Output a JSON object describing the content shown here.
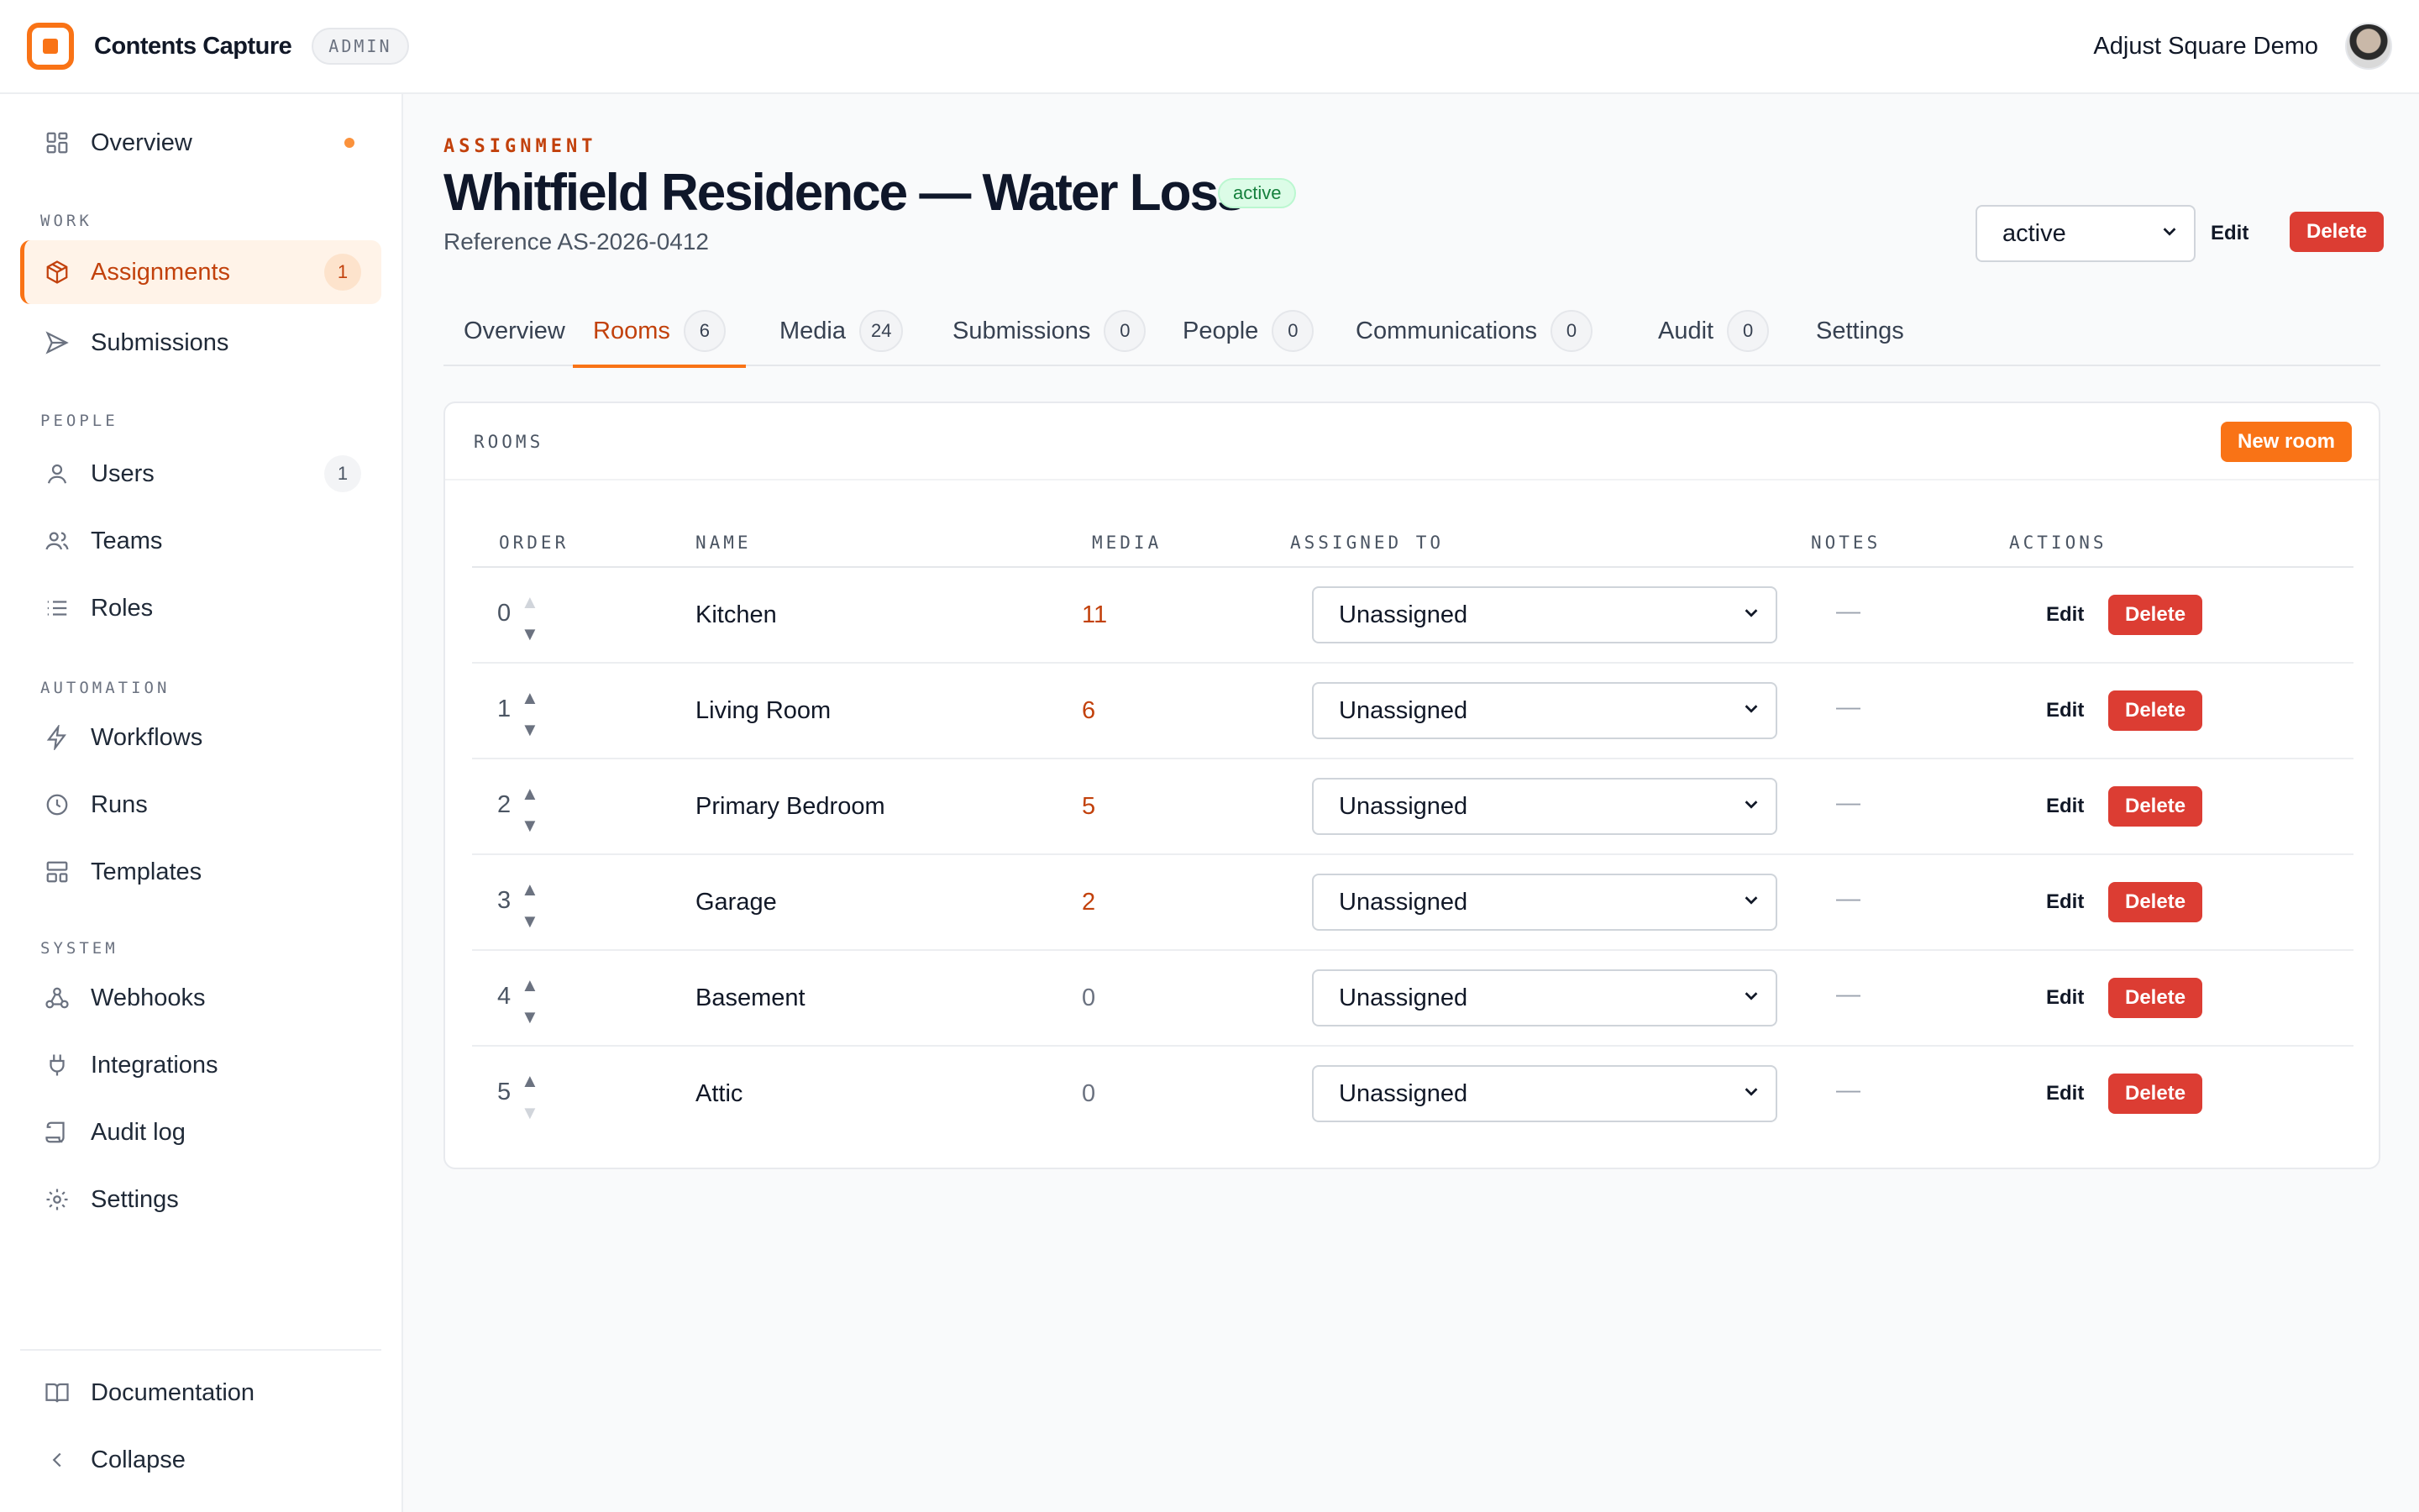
{
  "app": {
    "name": "Contents Capture",
    "badge": "ADMIN",
    "account": "Adjust Square Demo"
  },
  "colors": {
    "accent": "#f97316",
    "danger": "#dc3d33",
    "success": "#15803d"
  },
  "sidebar": {
    "sections": {
      "work": "WORK",
      "people": "PEOPLE",
      "automation": "AUTOMATION",
      "system": "SYSTEM"
    },
    "items": [
      {
        "label": "Overview",
        "icon": "grid-icon"
      },
      {
        "label": "Assignments",
        "icon": "box-icon",
        "count": "1",
        "active": true
      },
      {
        "label": "Submissions",
        "icon": "send-icon"
      },
      {
        "label": "Users",
        "icon": "user-icon",
        "count": "1"
      },
      {
        "label": "Teams",
        "icon": "users-icon"
      },
      {
        "label": "Roles",
        "icon": "list-icon"
      },
      {
        "label": "Workflows",
        "icon": "bolt-icon"
      },
      {
        "label": "Runs",
        "icon": "clock-icon"
      },
      {
        "label": "Templates",
        "icon": "layout-icon"
      },
      {
        "label": "Webhooks",
        "icon": "webhook-icon"
      },
      {
        "label": "Integrations",
        "icon": "plug-icon"
      },
      {
        "label": "Audit log",
        "icon": "scroll-icon"
      },
      {
        "label": "Settings",
        "icon": "gear-icon"
      }
    ],
    "footer": {
      "documentation": "Documentation",
      "collapse": "Collapse"
    }
  },
  "header": {
    "eyebrow": "ASSIGNMENT",
    "title": "Whitfield Residence — Water Loss",
    "status_pill": "active",
    "reference": "Reference AS-2026-0412",
    "status_select": "active",
    "edit_label": "Edit",
    "delete_label": "Delete"
  },
  "tabs": [
    {
      "label": "Overview"
    },
    {
      "label": "Rooms",
      "count": "6",
      "active": true
    },
    {
      "label": "Media",
      "count": "24"
    },
    {
      "label": "Submissions",
      "count": "0"
    },
    {
      "label": "People",
      "count": "0"
    },
    {
      "label": "Communications",
      "count": "0"
    },
    {
      "label": "Audit",
      "count": "0"
    },
    {
      "label": "Settings"
    }
  ],
  "rooms": {
    "title": "ROOMS",
    "new_label": "New room",
    "columns": [
      "ORDER",
      "NAME",
      "MEDIA",
      "ASSIGNED TO",
      "NOTES",
      "ACTIONS"
    ],
    "rows": [
      {
        "order": "0",
        "name": "Kitchen",
        "media": "11",
        "assigned": "Unassigned",
        "notes": "—"
      },
      {
        "order": "1",
        "name": "Living Room",
        "media": "6",
        "assigned": "Unassigned",
        "notes": "—"
      },
      {
        "order": "2",
        "name": "Primary Bedroom",
        "media": "5",
        "assigned": "Unassigned",
        "notes": "—"
      },
      {
        "order": "3",
        "name": "Garage",
        "media": "2",
        "assigned": "Unassigned",
        "notes": "—"
      },
      {
        "order": "4",
        "name": "Basement",
        "media": "0",
        "assigned": "Unassigned",
        "notes": "—"
      },
      {
        "order": "5",
        "name": "Attic",
        "media": "0",
        "assigned": "Unassigned",
        "notes": "—"
      }
    ],
    "edit_label": "Edit",
    "delete_label": "Delete",
    "up_glyph": "▲",
    "down_glyph": "▼"
  }
}
